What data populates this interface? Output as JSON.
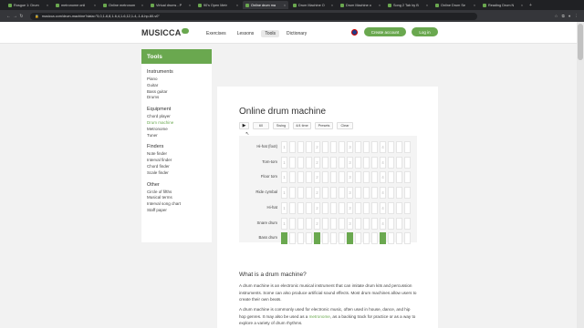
{
  "browser": {
    "tabs": [
      {
        "title": "Rosgue 1: Drum"
      },
      {
        "title": "metronome onli"
      },
      {
        "title": "Online metronom"
      },
      {
        "title": "Virtual drums - P"
      },
      {
        "title": "90's Open Metr"
      },
      {
        "title": "Online drum ma",
        "active": true
      },
      {
        "title": "Drum Machine O"
      },
      {
        "title": "Drum Machine o"
      },
      {
        "title": "Song 2 Tab by B"
      },
      {
        "title": "Online Drum Se"
      },
      {
        "title": "Reading Drum N"
      }
    ],
    "url": "musicca.com/drum-machine?data=\"5,0,1-6,8,1-6,4,1-6,12,1-4,-1-6-hp-60-v0\""
  },
  "site": {
    "logo": "MUSICCA",
    "nav": [
      "Exercises",
      "Lessons",
      "Tools",
      "Dictionary"
    ],
    "nav_active": "Tools",
    "create_account": "Create account",
    "login": "Log in"
  },
  "sidebar": {
    "heading": "Tools",
    "sections": [
      {
        "title": "Instruments",
        "items": [
          "Piano",
          "Guitar",
          "Bass guitar",
          "Drums"
        ]
      },
      {
        "title": "Equipment",
        "items": [
          "Chord player",
          "Drum machine",
          "Metronome",
          "Tuner"
        ],
        "active": "Drum machine"
      },
      {
        "title": "Finders",
        "items": [
          "Note finder",
          "Interval finder",
          "Chord finder",
          "Scale finder"
        ]
      },
      {
        "title": "Other",
        "items": [
          "Circle of fifths",
          "Musical terms",
          "Interval song chart",
          "Staff paper"
        ]
      }
    ]
  },
  "main": {
    "title": "Online drum machine",
    "controls": {
      "play": "▶",
      "bpm": "60",
      "swing": "Swing",
      "time": "4/4 time",
      "presets": "Presets",
      "clear": "Clear"
    },
    "instruments": [
      "Hi-hat (foot)",
      "Tom-tom",
      "Floor tom",
      "Ride cymbal",
      "Hi-hat",
      "Snare drum",
      "Bass drum"
    ],
    "beat_numbers": [
      "1",
      "2",
      "3",
      "4"
    ],
    "steps": 16,
    "pattern": {
      "Bass drum": [
        0,
        4,
        8,
        12
      ]
    },
    "section_title": "What is a drum machine?",
    "para1": "A drum machine is an electronic musical instrument that can imitate drum kits and percussion instruments. Some can also produce artificial sound effects. Most drum machines allow users to create their own beats.",
    "para2_a": "A drum machine is commonly used for electronic music, often used in house, dance, and hip hop genres. It may also be used as a ",
    "para2_link": "metronome",
    "para2_b": ", as a backing track for practice or as a way to explore a variety of drum rhythms."
  },
  "colors": {
    "accent": "#6aa84f"
  }
}
